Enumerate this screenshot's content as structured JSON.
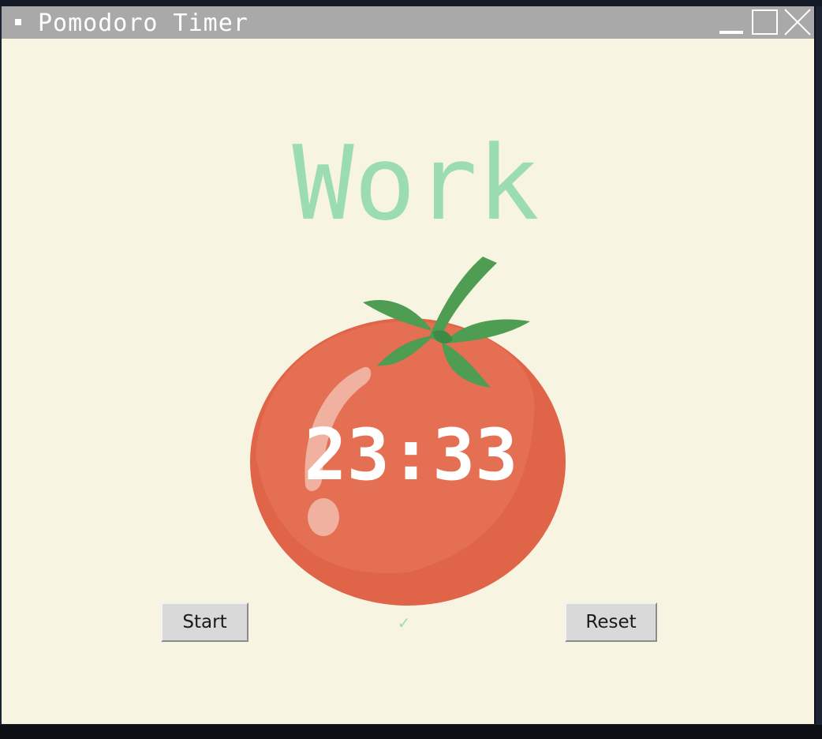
{
  "window": {
    "title": "Pomodoro Timer",
    "controls": {
      "minimize": "minimize-icon",
      "maximize": "maximize-icon",
      "close": "close-icon"
    }
  },
  "timer": {
    "mode_label": "Work",
    "time_display": "23:33",
    "checkmarks": "✓"
  },
  "buttons": {
    "start_label": "Start",
    "reset_label": "Reset"
  },
  "colors": {
    "background": "#f7f4e1",
    "mode_label": "#9bdcb1",
    "tomato": "#e26a4c",
    "leaf": "#4f9d52",
    "titlebar": "#a9a9a9"
  },
  "image": {
    "icon": "tomato-icon"
  }
}
